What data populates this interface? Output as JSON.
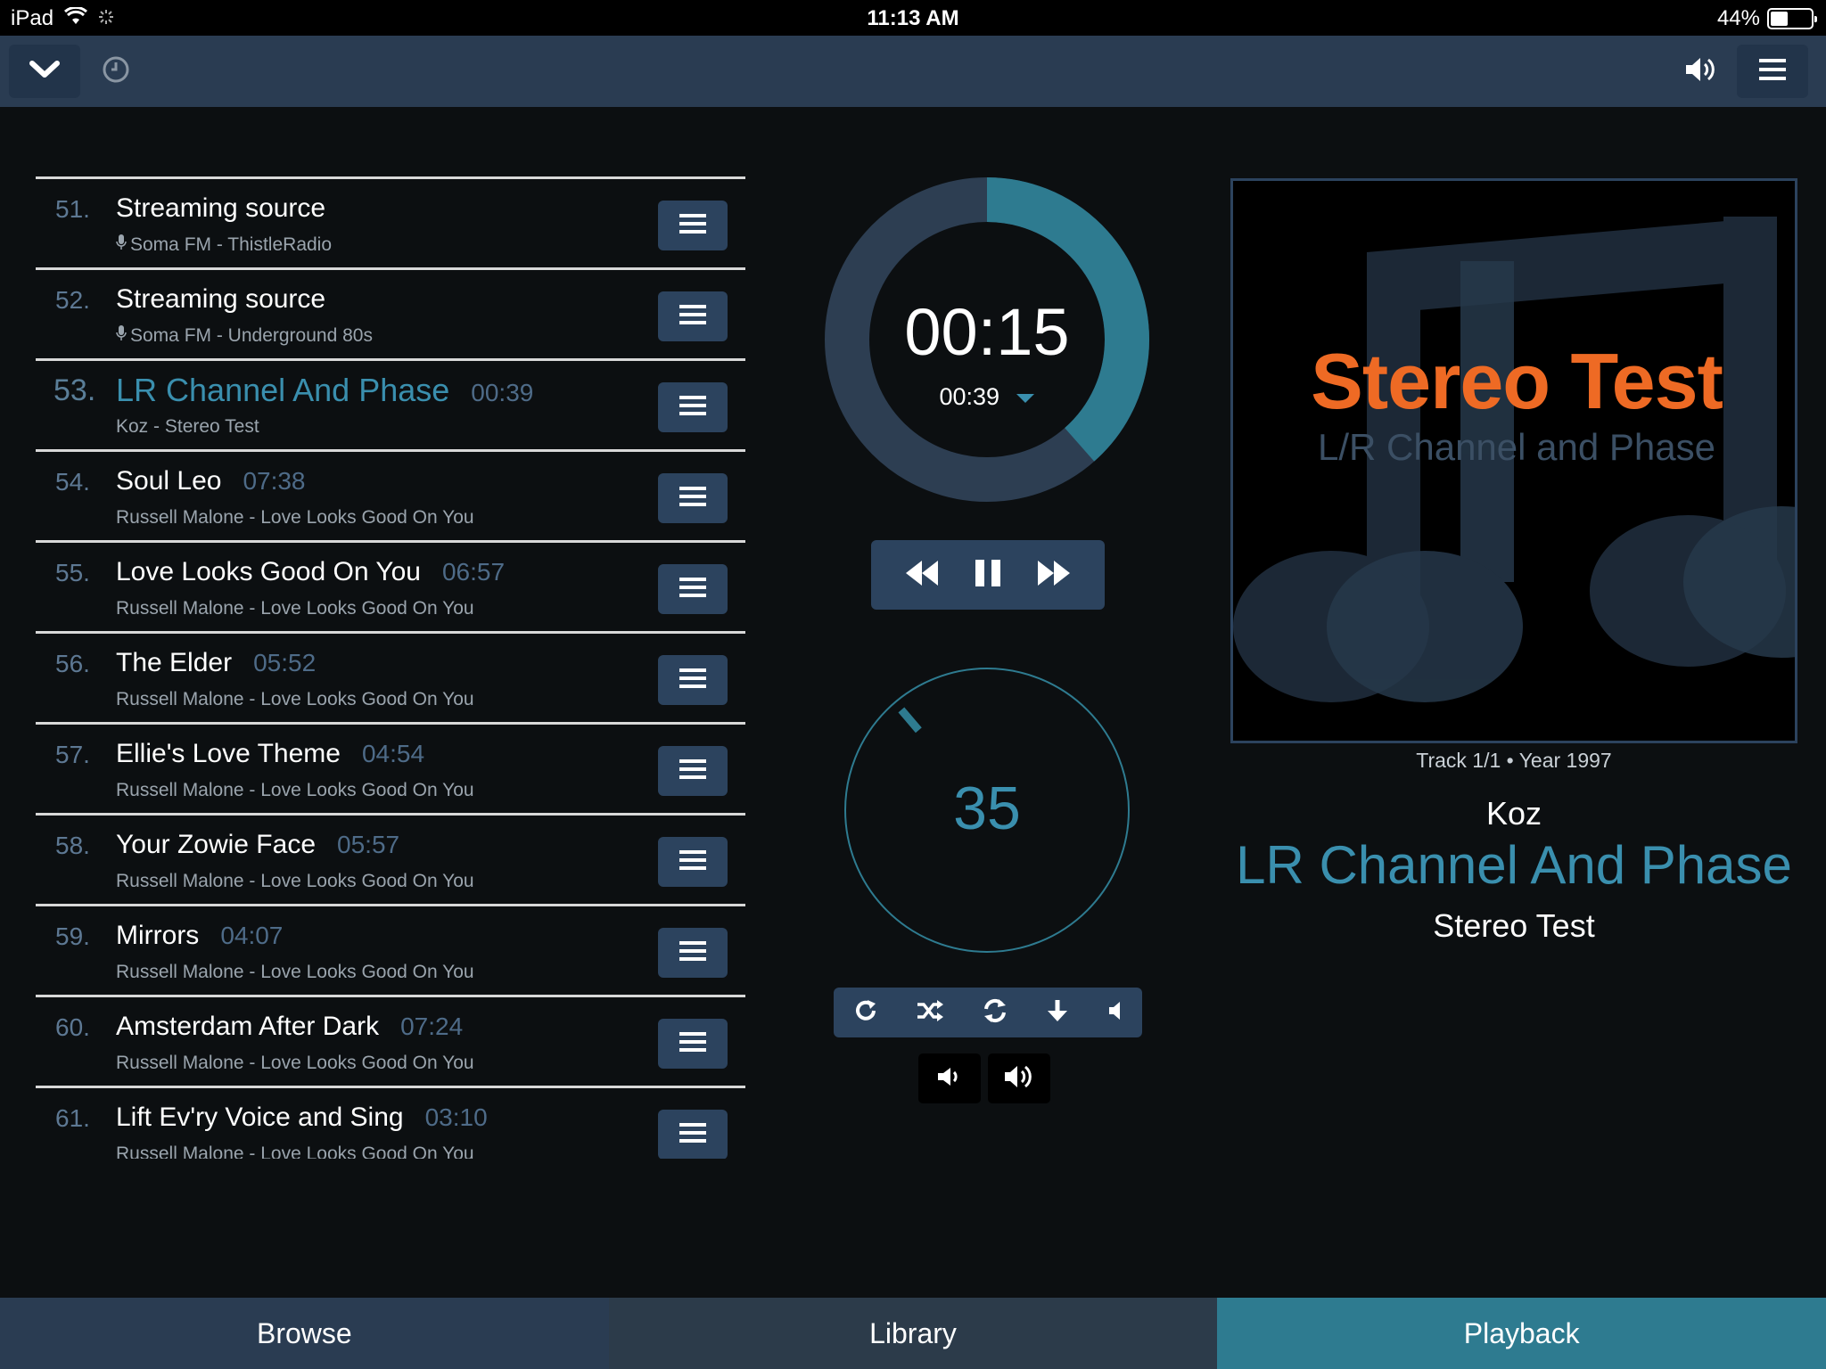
{
  "status_bar": {
    "device": "iPad",
    "time": "11:13 AM",
    "battery": "44%",
    "battery_level": 0.44
  },
  "toolbar": {
    "collapse_icon": "chevron-down-icon",
    "history_icon": "clock-icon",
    "volume_icon": "speaker-icon",
    "menu_icon": "hamburger-icon"
  },
  "playlist": [
    {
      "num": "51.",
      "title": "Streaming source",
      "duration": "",
      "subtitle": "Soma FM - ThistleRadio",
      "stream": true,
      "active": false
    },
    {
      "num": "52.",
      "title": "Streaming source",
      "duration": "",
      "subtitle": "Soma FM - Underground 80s",
      "stream": true,
      "active": false
    },
    {
      "num": "53.",
      "title": "LR Channel And Phase",
      "duration": "00:39",
      "subtitle": "Koz - Stereo Test",
      "stream": false,
      "active": true
    },
    {
      "num": "54.",
      "title": "Soul Leo",
      "duration": "07:38",
      "subtitle": "Russell Malone - Love Looks Good On You",
      "stream": false,
      "active": false
    },
    {
      "num": "55.",
      "title": "Love Looks Good On You",
      "duration": "06:57",
      "subtitle": "Russell Malone - Love Looks Good On You",
      "stream": false,
      "active": false
    },
    {
      "num": "56.",
      "title": "The Elder",
      "duration": "05:52",
      "subtitle": "Russell Malone - Love Looks Good On You",
      "stream": false,
      "active": false
    },
    {
      "num": "57.",
      "title": "Ellie's Love Theme",
      "duration": "04:54",
      "subtitle": "Russell Malone - Love Looks Good On You",
      "stream": false,
      "active": false
    },
    {
      "num": "58.",
      "title": "Your Zowie Face",
      "duration": "05:57",
      "subtitle": "Russell Malone - Love Looks Good On You",
      "stream": false,
      "active": false
    },
    {
      "num": "59.",
      "title": "Mirrors",
      "duration": "04:07",
      "subtitle": "Russell Malone - Love Looks Good On You",
      "stream": false,
      "active": false
    },
    {
      "num": "60.",
      "title": "Amsterdam After Dark",
      "duration": "07:24",
      "subtitle": "Russell Malone - Love Looks Good On You",
      "stream": false,
      "active": false
    },
    {
      "num": "61.",
      "title": "Lift Ev'ry Voice and Sing",
      "duration": "03:10",
      "subtitle": "Russell Malone - Love Looks Good On You",
      "stream": false,
      "active": false
    }
  ],
  "player": {
    "elapsed": "00:15",
    "total": "00:39",
    "progress_fraction": 0.385,
    "volume": "35",
    "volume_level": 0.35
  },
  "now_playing": {
    "art_title": "Stereo Test",
    "art_subtitle": "L/R Channel and Phase",
    "track_info": "Track 1/1 • Year 1997",
    "artist": "Koz",
    "title": "LR Channel And Phase",
    "album": "Stereo Test"
  },
  "tabs": {
    "browse": "Browse",
    "library": "Library",
    "playback": "Playback"
  },
  "colors": {
    "accent": "#3a8fae",
    "toolbar": "#2a3c52",
    "button": "#2c435e",
    "art_title": "#ee6a24"
  }
}
